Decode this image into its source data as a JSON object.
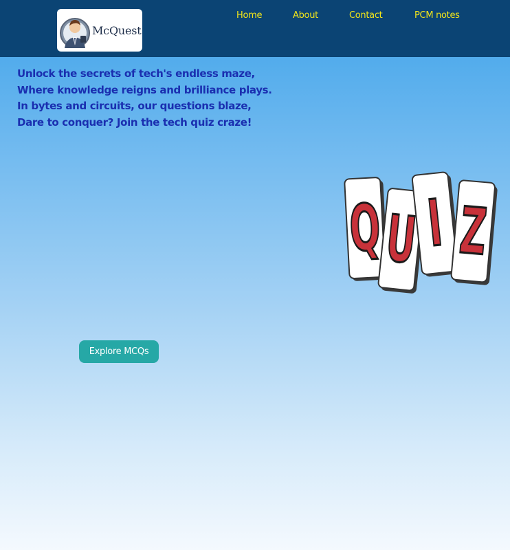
{
  "header": {
    "logo_text": "McQuest",
    "nav": [
      {
        "label": "Home"
      },
      {
        "label": "About"
      },
      {
        "label": "Contact"
      },
      {
        "label": "PCM notes"
      }
    ]
  },
  "hero": {
    "poem_lines": [
      "Unlock the secrets of tech's endless maze,",
      "Where knowledge reigns and brilliance plays.",
      "In bytes and circuits, our questions blaze,",
      "Dare to conquer? Join the tech quiz craze!"
    ],
    "cta_label": "Explore MCQs",
    "quiz_letters": [
      "Q",
      "U",
      "I",
      "Z"
    ]
  },
  "colors": {
    "navbar_bg": "#0b4474",
    "nav_link": "#f2e51a",
    "poem_text": "#1a2fb0",
    "cta_bg": "#26a8a6",
    "quiz_letter": "#c8323a"
  },
  "icons": {
    "logo": "businessman-avatar-icon"
  }
}
